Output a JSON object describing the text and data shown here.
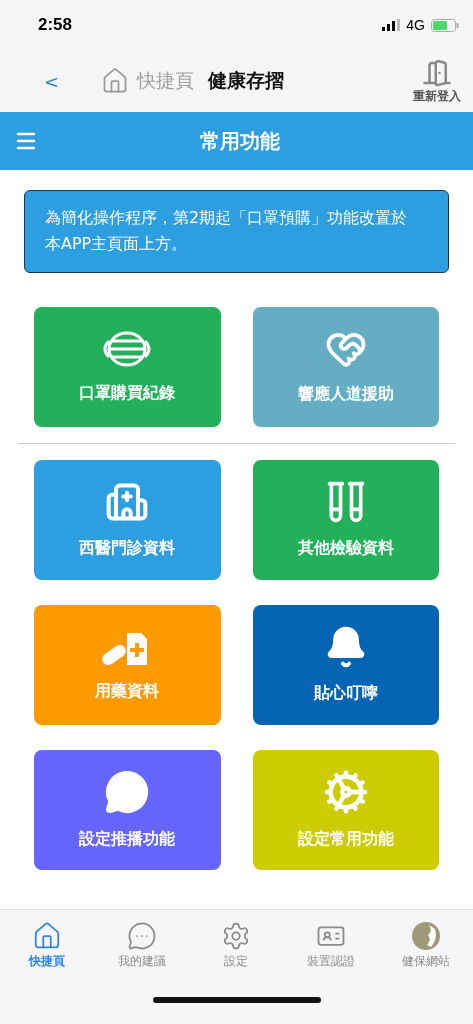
{
  "status_bar": {
    "time": "2:58",
    "network": "4G"
  },
  "header": {
    "back": "<",
    "home_label": "快捷頁",
    "title": "健康存摺",
    "logout": "重新登入"
  },
  "section_bar": {
    "title": "常用功能"
  },
  "notice": "為簡化操作程序，第2期起「口罩預購」功能改置於本APP主頁面上方。",
  "tile_groups": [
    [
      {
        "label": "口罩購買紀錄",
        "color": "#23b05a"
      },
      {
        "label": "響應人道援助",
        "color": "#64adc2"
      }
    ],
    [
      {
        "label": "西醫門診資料",
        "color": "#2d9fe0"
      },
      {
        "label": "其他檢驗資料",
        "color": "#23b05a"
      },
      {
        "label": "用藥資料",
        "color": "#fd9a00"
      },
      {
        "label": "貼心叮嚀",
        "color": "#0565b4"
      },
      {
        "label": "設定推播功能",
        "color": "#6666ff"
      },
      {
        "label": "設定常用功能",
        "color": "#cccc00"
      }
    ]
  ],
  "tab_bar": [
    {
      "label": "快捷頁",
      "selected": true
    },
    {
      "label": "我的建議",
      "selected": false
    },
    {
      "label": "設定",
      "selected": false
    },
    {
      "label": "裝置認證",
      "selected": false
    },
    {
      "label": "健保網站",
      "selected": false
    }
  ]
}
